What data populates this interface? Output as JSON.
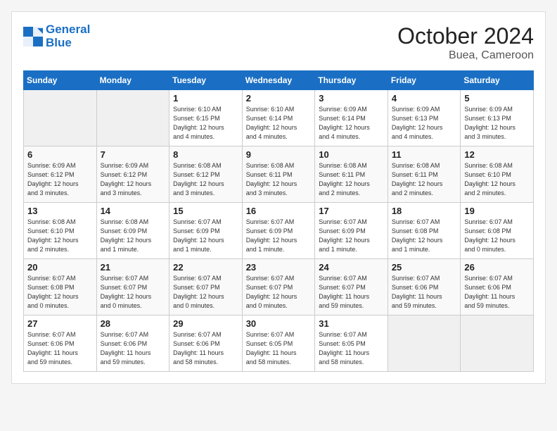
{
  "logo": {
    "line1": "General",
    "line2": "Blue"
  },
  "title": "October 2024",
  "location": "Buea, Cameroon",
  "days_header": [
    "Sunday",
    "Monday",
    "Tuesday",
    "Wednesday",
    "Thursday",
    "Friday",
    "Saturday"
  ],
  "weeks": [
    [
      {
        "num": "",
        "info": ""
      },
      {
        "num": "",
        "info": ""
      },
      {
        "num": "1",
        "info": "Sunrise: 6:10 AM\nSunset: 6:15 PM\nDaylight: 12 hours\nand 4 minutes."
      },
      {
        "num": "2",
        "info": "Sunrise: 6:10 AM\nSunset: 6:14 PM\nDaylight: 12 hours\nand 4 minutes."
      },
      {
        "num": "3",
        "info": "Sunrise: 6:09 AM\nSunset: 6:14 PM\nDaylight: 12 hours\nand 4 minutes."
      },
      {
        "num": "4",
        "info": "Sunrise: 6:09 AM\nSunset: 6:13 PM\nDaylight: 12 hours\nand 4 minutes."
      },
      {
        "num": "5",
        "info": "Sunrise: 6:09 AM\nSunset: 6:13 PM\nDaylight: 12 hours\nand 3 minutes."
      }
    ],
    [
      {
        "num": "6",
        "info": "Sunrise: 6:09 AM\nSunset: 6:12 PM\nDaylight: 12 hours\nand 3 minutes."
      },
      {
        "num": "7",
        "info": "Sunrise: 6:09 AM\nSunset: 6:12 PM\nDaylight: 12 hours\nand 3 minutes."
      },
      {
        "num": "8",
        "info": "Sunrise: 6:08 AM\nSunset: 6:12 PM\nDaylight: 12 hours\nand 3 minutes."
      },
      {
        "num": "9",
        "info": "Sunrise: 6:08 AM\nSunset: 6:11 PM\nDaylight: 12 hours\nand 3 minutes."
      },
      {
        "num": "10",
        "info": "Sunrise: 6:08 AM\nSunset: 6:11 PM\nDaylight: 12 hours\nand 2 minutes."
      },
      {
        "num": "11",
        "info": "Sunrise: 6:08 AM\nSunset: 6:11 PM\nDaylight: 12 hours\nand 2 minutes."
      },
      {
        "num": "12",
        "info": "Sunrise: 6:08 AM\nSunset: 6:10 PM\nDaylight: 12 hours\nand 2 minutes."
      }
    ],
    [
      {
        "num": "13",
        "info": "Sunrise: 6:08 AM\nSunset: 6:10 PM\nDaylight: 12 hours\nand 2 minutes."
      },
      {
        "num": "14",
        "info": "Sunrise: 6:08 AM\nSunset: 6:09 PM\nDaylight: 12 hours\nand 1 minute."
      },
      {
        "num": "15",
        "info": "Sunrise: 6:07 AM\nSunset: 6:09 PM\nDaylight: 12 hours\nand 1 minute."
      },
      {
        "num": "16",
        "info": "Sunrise: 6:07 AM\nSunset: 6:09 PM\nDaylight: 12 hours\nand 1 minute."
      },
      {
        "num": "17",
        "info": "Sunrise: 6:07 AM\nSunset: 6:09 PM\nDaylight: 12 hours\nand 1 minute."
      },
      {
        "num": "18",
        "info": "Sunrise: 6:07 AM\nSunset: 6:08 PM\nDaylight: 12 hours\nand 1 minute."
      },
      {
        "num": "19",
        "info": "Sunrise: 6:07 AM\nSunset: 6:08 PM\nDaylight: 12 hours\nand 0 minutes."
      }
    ],
    [
      {
        "num": "20",
        "info": "Sunrise: 6:07 AM\nSunset: 6:08 PM\nDaylight: 12 hours\nand 0 minutes."
      },
      {
        "num": "21",
        "info": "Sunrise: 6:07 AM\nSunset: 6:07 PM\nDaylight: 12 hours\nand 0 minutes."
      },
      {
        "num": "22",
        "info": "Sunrise: 6:07 AM\nSunset: 6:07 PM\nDaylight: 12 hours\nand 0 minutes."
      },
      {
        "num": "23",
        "info": "Sunrise: 6:07 AM\nSunset: 6:07 PM\nDaylight: 12 hours\nand 0 minutes."
      },
      {
        "num": "24",
        "info": "Sunrise: 6:07 AM\nSunset: 6:07 PM\nDaylight: 11 hours\nand 59 minutes."
      },
      {
        "num": "25",
        "info": "Sunrise: 6:07 AM\nSunset: 6:06 PM\nDaylight: 11 hours\nand 59 minutes."
      },
      {
        "num": "26",
        "info": "Sunrise: 6:07 AM\nSunset: 6:06 PM\nDaylight: 11 hours\nand 59 minutes."
      }
    ],
    [
      {
        "num": "27",
        "info": "Sunrise: 6:07 AM\nSunset: 6:06 PM\nDaylight: 11 hours\nand 59 minutes."
      },
      {
        "num": "28",
        "info": "Sunrise: 6:07 AM\nSunset: 6:06 PM\nDaylight: 11 hours\nand 59 minutes."
      },
      {
        "num": "29",
        "info": "Sunrise: 6:07 AM\nSunset: 6:06 PM\nDaylight: 11 hours\nand 58 minutes."
      },
      {
        "num": "30",
        "info": "Sunrise: 6:07 AM\nSunset: 6:05 PM\nDaylight: 11 hours\nand 58 minutes."
      },
      {
        "num": "31",
        "info": "Sunrise: 6:07 AM\nSunset: 6:05 PM\nDaylight: 11 hours\nand 58 minutes."
      },
      {
        "num": "",
        "info": ""
      },
      {
        "num": "",
        "info": ""
      }
    ]
  ]
}
